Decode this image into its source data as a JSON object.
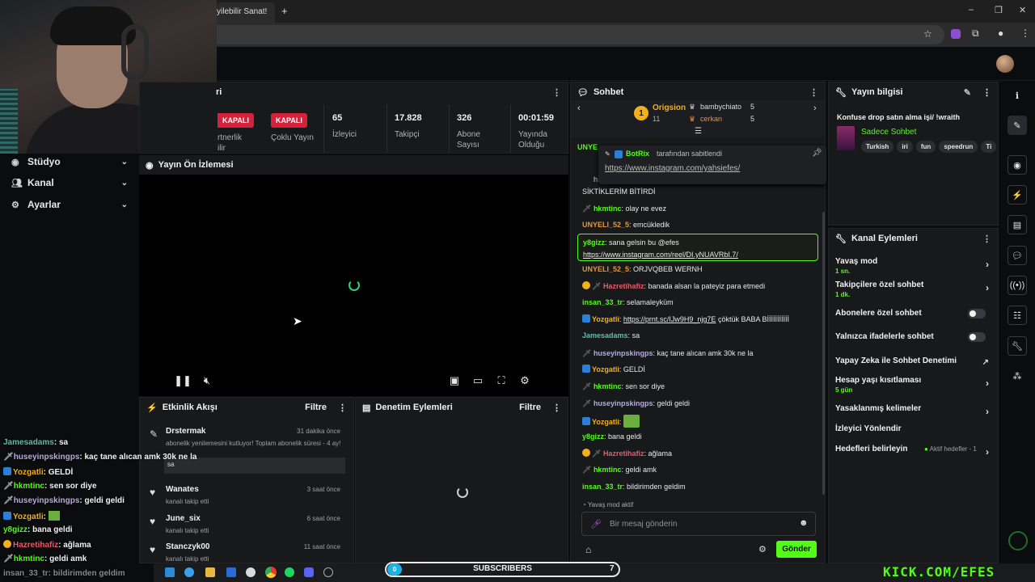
{
  "browser": {
    "tab_title": "yilebilir Sanat!",
    "new_tab": "+",
    "window_controls": [
      "–",
      "❐",
      "✕"
    ]
  },
  "left_nav": [
    {
      "label": "Stüdyo",
      "icon": "camera-icon"
    },
    {
      "label": "Kanal",
      "icon": "people-icon"
    },
    {
      "label": "Ayarlar",
      "icon": "gear-icon"
    }
  ],
  "stats_panel": {
    "title_fragment": "ri",
    "items": [
      {
        "badge": "KAPALI",
        "label": "rtnerlik\nilir"
      },
      {
        "badge": "KAPALI",
        "label": "Çoklu Yayın"
      },
      {
        "value": "65",
        "label": "İzleyici"
      },
      {
        "value": "17.828",
        "label": "Takipçi"
      },
      {
        "value": "326",
        "label": "Abone\nSayısı"
      },
      {
        "value": "00:01:59",
        "label": "Yayında\nOlduğu"
      }
    ]
  },
  "preview": {
    "title": "Yayın Ön İzlemesi"
  },
  "activity": {
    "title": "Etkinlik Akışı",
    "filter": "Filtre",
    "items": [
      {
        "name": "Drstermak",
        "time": "31 dakika önce",
        "text": "abonelik yenilemesini kutluyor! Toplam abonelik süresi - 4 ay!",
        "note": "sa"
      },
      {
        "name": "Wanates",
        "time": "3 saat önce",
        "text": "kanalı takip etti"
      },
      {
        "name": "June_six",
        "time": "6 saat önce",
        "text": "kanalı takip etti"
      },
      {
        "name": "Stanczyk00",
        "time": "11 saat önce",
        "text": "kanalı takip etti"
      }
    ]
  },
  "moderation": {
    "title": "Denetim Eylemleri",
    "filter": "Filtre"
  },
  "chat": {
    "title": "Sohbet",
    "leaderboard": {
      "rank": "1",
      "top": {
        "name": "Origsion",
        "count": "11"
      },
      "others": [
        {
          "name": "bambychiato",
          "count": "5"
        },
        {
          "name": "cerkan",
          "count": "5"
        }
      ]
    },
    "pinned": {
      "by": "BotRix",
      "by_suffix": "tarafından sabitlendi",
      "link": "https://www.instagram.com/yahsiefes/"
    },
    "partial_top": [
      "UNYE",
      "hı"
    ],
    "messages": [
      {
        "user": "",
        "text": "SİKTİKLERİM BİTİRDİ"
      },
      {
        "user": "hkmtinc",
        "text": "olay ne evez"
      },
      {
        "user": "UNYELI_52_5",
        "text": "emcükledik"
      },
      {
        "user": "y8gizz",
        "text": "sana gelsin bu @efes",
        "link": "https://www.instagram.com/reel/DI.yNUAVRbI.7/"
      },
      {
        "user": "UNYELI_52_5",
        "text": "ORJVQBEB WERNH"
      },
      {
        "user": "Hazretihafiz",
        "text": "banada alsan la pateyiz para etmedi"
      },
      {
        "user": "insan_33_tr",
        "text": "selamaleyküm"
      },
      {
        "user": "Yozgatli",
        "link": "https://prnt.sc/IJw9H9_njg7E",
        "text": "çöktük BABA Bİİİİİİİİİİİ"
      },
      {
        "user": "Jamesadams",
        "text": "sa"
      },
      {
        "user": "huseyinpskingps",
        "text": "kaç tane alıcan amk 30k ne la"
      },
      {
        "user": "Yozgatli",
        "text": "GELDİ"
      },
      {
        "user": "hkmtinc",
        "text": "sen sor diye"
      },
      {
        "user": "huseyinpskingps",
        "text": "geldi geldi"
      },
      {
        "user": "Yozgatli",
        "text": ""
      },
      {
        "user": "y8gizz",
        "text": "bana geldi"
      },
      {
        "user": "Hazretihafiz",
        "text": "ağlama"
      },
      {
        "user": "hkmtinc",
        "text": "geldi amk"
      },
      {
        "user": "insan_33_tr",
        "text": "bildirimden geldim"
      }
    ],
    "slow_mode": "Yavaş mod aktif",
    "input_placeholder": "Bir mesaj gönderin",
    "send": "Gönder"
  },
  "stream_info": {
    "title": "Yayın bilgisi",
    "stream_title": "Konfuse drop satın alma işi/ !wraith",
    "category": "Sadece Sohbet",
    "tags": [
      "Turkish",
      "iri",
      "fun",
      "speedrun",
      "Ti"
    ]
  },
  "channel_actions": {
    "title": "Kanal Eylemleri",
    "items": [
      {
        "label": "Yavaş mod",
        "sub": "1 sn.",
        "control": "arrow"
      },
      {
        "label": "Takipçilere özel sohbet",
        "sub": "1 dk.",
        "control": "arrow"
      },
      {
        "label": "Abonelere özel sohbet",
        "control": "toggle"
      },
      {
        "label": "Yalnızca ifadelerle sohbet",
        "control": "toggle"
      },
      {
        "label": "Yapay Zeka ile Sohbet Denetimi",
        "control": "external"
      },
      {
        "label": "Hesap yaşı kısıtlaması",
        "sub": "5 gün",
        "control": "arrow"
      },
      {
        "label": "Yasaklanmış kelimeler",
        "control": "arrow"
      },
      {
        "label": "İzleyici Yönlendir",
        "control": "none"
      },
      {
        "label": "Hedefleri belirleyin",
        "status": "Aktif hedefler - 1",
        "control": "arrow"
      }
    ]
  },
  "overlay_chat": [
    {
      "user": "Jamesadams",
      "text": "sa"
    },
    {
      "user": "huseyinpskingps",
      "text": "kaç tane alıcan amk 30k ne la"
    },
    {
      "user": "Yozgatli",
      "text": "GELDİ"
    },
    {
      "user": "hkmtinc",
      "text": "sen sor diye"
    },
    {
      "user": "huseyinpskingps",
      "text": "geldi geldi"
    },
    {
      "user": "Yozgatli",
      "text": ""
    },
    {
      "user": "y8gizz",
      "text": "bana geldi"
    },
    {
      "user": "Hazretihafiz",
      "text": "ağlama"
    },
    {
      "user": "hkmtinc",
      "text": "geldi amk"
    },
    {
      "user": "insan_33_tr",
      "text": "bildirimden geldim"
    }
  ],
  "stream_bar": {
    "left_count": "0",
    "label": "SUBSCRIBERS",
    "right_count": "7"
  },
  "brand": "KICK.COM/EFES",
  "colors": {
    "accent": "#53fc18",
    "badge_red": "#d5223a",
    "panel": "#18191b"
  }
}
